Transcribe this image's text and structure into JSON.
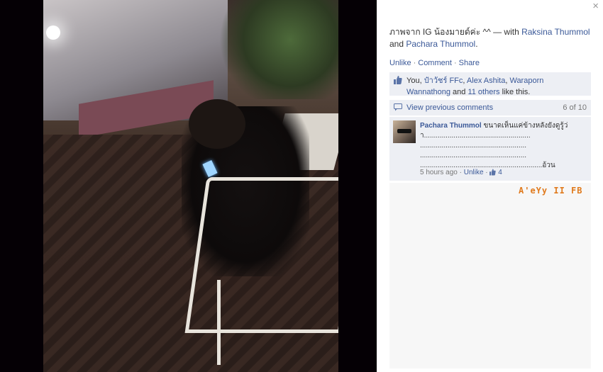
{
  "photo": {
    "alt": ""
  },
  "sidebar": {
    "close_icon": "×",
    "caption": {
      "text": "ภาพจาก IG น้องมายด์ค่ะ ^^",
      "with_sep": " — with ",
      "friend1": "Raksina Thummol",
      "and": " and ",
      "friend2": "Pachara Thummol",
      "end": "."
    },
    "actions": {
      "unlike": "Unlike",
      "comment": "Comment",
      "share": "Share"
    },
    "likes": {
      "you": "You, ",
      "p1": "ป๋าวัชร์ FFc",
      "sep1": ", ",
      "p2": "Alex Ashita",
      "sep2": ", ",
      "p3": "Waraporn Wannathong",
      "and": " and ",
      "others": "11 others",
      "tail": " like this."
    },
    "previous": {
      "label": "View previous comments",
      "count": "6 of 10"
    },
    "comment": {
      "author": "Pachara Thummol",
      "text": " ขนาดเห็นแค่ข้างหลังยังดูรู้ว่า...................................................... ...................................................... ...................................................... ..............................................................อ้วน",
      "time": "5 hours ago",
      "unlike": "Unlike",
      "like_count": "4"
    },
    "watermark": "A'eYy II FB"
  },
  "colors": {
    "link": "#3b5998",
    "panel": "#edeff4",
    "watermark": "#e07a1d"
  }
}
